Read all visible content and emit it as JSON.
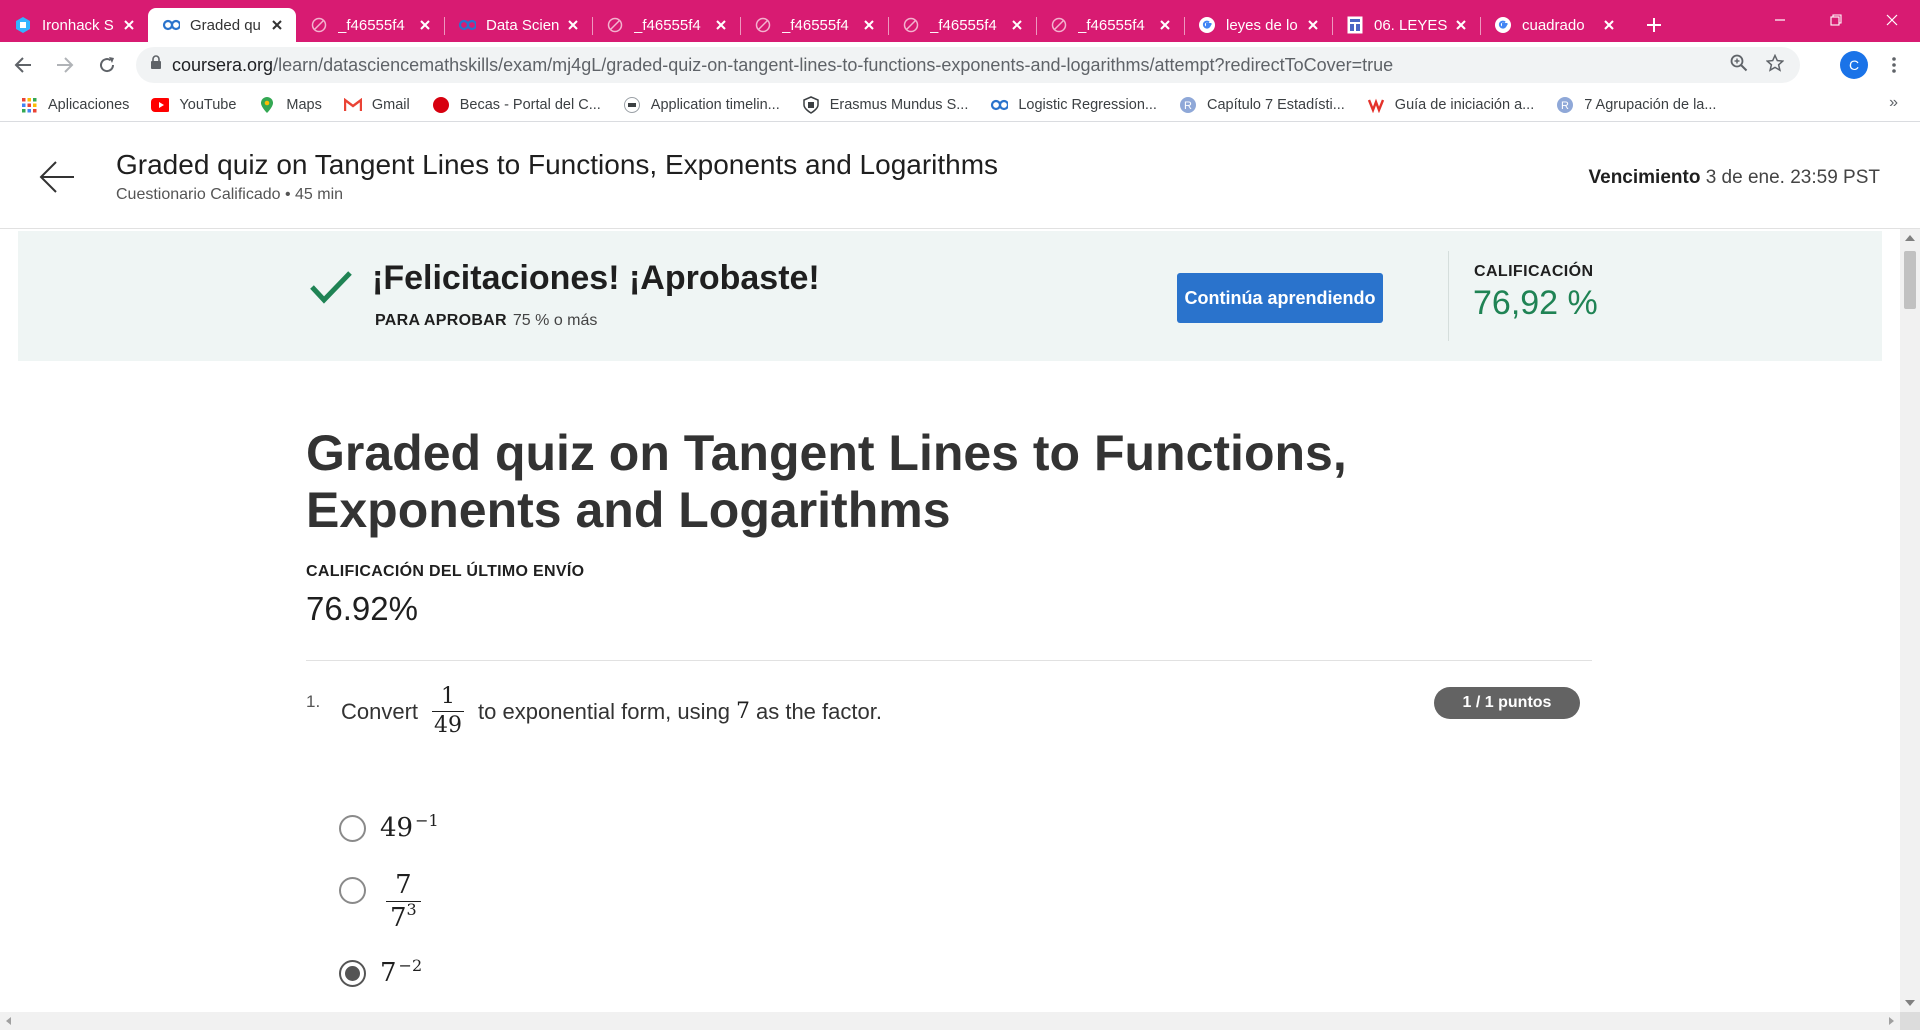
{
  "browser": {
    "tabs": [
      {
        "title": "Ironhack S",
        "icon": "ironhack-icon",
        "active": false
      },
      {
        "title": "Graded qu",
        "icon": "coursera-icon",
        "active": true
      },
      {
        "title": "_f46555f4",
        "icon": "globe-icon",
        "active": false
      },
      {
        "title": "Data Scien",
        "icon": "coursera-icon",
        "active": false
      },
      {
        "title": "_f46555f4",
        "icon": "globe-icon",
        "active": false
      },
      {
        "title": "_f46555f4",
        "icon": "globe-icon",
        "active": false
      },
      {
        "title": "_f46555f4",
        "icon": "globe-icon",
        "active": false
      },
      {
        "title": "_f46555f4",
        "icon": "globe-icon",
        "active": false
      },
      {
        "title": "leyes de lo",
        "icon": "google-icon",
        "active": false
      },
      {
        "title": "06. LEYES",
        "icon": "document-icon",
        "active": false
      },
      {
        "title": "cuadrado",
        "icon": "google-icon",
        "active": false
      }
    ],
    "tab_color": "#d81b72",
    "url_host": "coursera.org",
    "url_path": "/learn/datasciencemathskills/exam/mj4gL/graded-quiz-on-tangent-lines-to-functions-exponents-and-logarithms/attempt?redirectToCover=true",
    "profile_initial": "C",
    "bookmarks": [
      {
        "label": "Aplicaciones",
        "icon": "apps-grid-icon"
      },
      {
        "label": "YouTube",
        "icon": "youtube-icon"
      },
      {
        "label": "Maps",
        "icon": "maps-pin-icon"
      },
      {
        "label": "Gmail",
        "icon": "gmail-icon"
      },
      {
        "label": "Becas - Portal del C...",
        "icon": "red-circle-icon"
      },
      {
        "label": "Application timelin...",
        "icon": "site-icon"
      },
      {
        "label": "Erasmus Mundus S...",
        "icon": "shield-site-icon"
      },
      {
        "label": "Logistic Regression...",
        "icon": "coursera-icon"
      },
      {
        "label": "Capítulo 7 Estadísti...",
        "icon": "r-icon"
      },
      {
        "label": "Guía de iniciación a...",
        "icon": "u-icon"
      },
      {
        "label": "7 Agrupación de la...",
        "icon": "r-icon"
      }
    ],
    "bookmarks_more": "»"
  },
  "header": {
    "title": "Graded quiz on Tangent Lines to Functions, Exponents and Logarithms",
    "subtitle": "Cuestionario Calificado • 45 min",
    "due_label": "Vencimiento",
    "due_value": "3 de ene. 23:59 PST"
  },
  "banner": {
    "congrats": "¡Felicitaciones! ¡Aprobaste!",
    "pass_label": "PARA APROBAR",
    "pass_value": "75 % o más",
    "continue_button": "Continúa aprendiendo",
    "grade_label": "CALIFICACIÓN",
    "grade_value": "76,92 %",
    "grade_color": "#1f8354",
    "button_color": "#2a73cc"
  },
  "main": {
    "title": "Graded quiz on Tangent Lines to Functions, Exponents and Logarithms",
    "last_submission_label": "CALIFICACIÓN DEL ÚLTIMO ENVÍO",
    "last_submission_value": "76.92%",
    "question": {
      "number": "1.",
      "text_before": "Convert",
      "fraction_num": "1",
      "fraction_den": "49",
      "text_middle": "to exponential form, using",
      "factor": "7",
      "text_after": "as the factor.",
      "points": "1 / 1 puntos",
      "options": [
        {
          "base": "49",
          "exp": "−1",
          "checked": false
        },
        {
          "num": "7",
          "den_base": "7",
          "den_exp": "3",
          "checked": false
        },
        {
          "base": "7",
          "exp": "−2",
          "checked": true
        }
      ]
    }
  }
}
